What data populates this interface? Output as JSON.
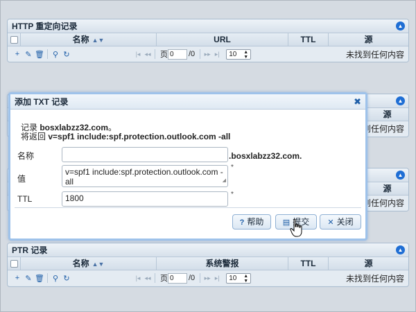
{
  "http_panel": {
    "title": "HTTP 重定向记录",
    "columns": {
      "name": "名称",
      "url": "URL",
      "ttl": "TTL",
      "source": "源"
    },
    "pager": {
      "page_label": "页",
      "page_value": "0",
      "page_total": "/0",
      "page_size": "10",
      "empty": "未找到任何内容"
    }
  },
  "hidden_panel_2": {
    "source_col": "源",
    "empty": "未找到任何内容"
  },
  "hidden_panel_3": {
    "source_col": "源",
    "empty": "未找到任何内容"
  },
  "ptr_panel": {
    "title": "PTR 记录",
    "columns": {
      "name": "名称",
      "alert": "系统警报",
      "ttl": "TTL",
      "source": "源"
    },
    "pager": {
      "page_label": "页",
      "page_value": "0",
      "page_total": "/0",
      "page_size": "10",
      "empty": "未找到任何内容"
    }
  },
  "dialog": {
    "title": "添加 TXT 记录",
    "info_line1_prefix": "记录 ",
    "info_line1_domain": "bosxlabzz32.com",
    "info_line1_suffix": "。",
    "info_line2_prefix": "将返回 ",
    "info_line2_value": "v=spf1 include:spf.protection.outlook.com -all",
    "name_label": "名称",
    "name_value": "",
    "domain_suffix": ".bosxlabzz32.com.",
    "value_label": "值",
    "value_value": "v=spf1 include:spf.protection.outlook.com -all",
    "ttl_label": "TTL",
    "ttl_value": "1800",
    "required_mark": "*",
    "help_button": "帮助",
    "submit_button": "提交",
    "close_button": "关闭"
  },
  "colors": {
    "accent": "#1f6ed4",
    "panel_bg": "#dfe7ef",
    "dialog_border": "#9ec2ea"
  }
}
